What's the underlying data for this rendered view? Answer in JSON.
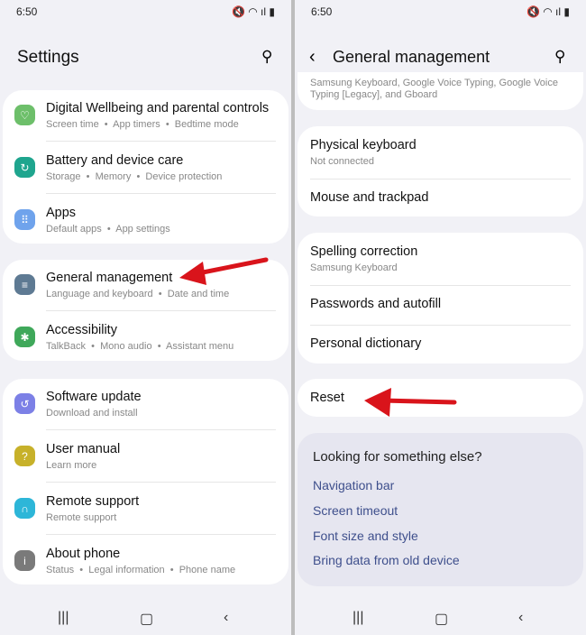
{
  "status": {
    "time": "6:50",
    "left_icons": [
      "gallery-icon",
      "dnd-icon",
      "accessibility-icon",
      "dot"
    ],
    "right_icons": [
      "mute-icon",
      "wifi-icon",
      "signal-icon",
      "battery-icon"
    ]
  },
  "left": {
    "title": "Settings",
    "groups": [
      [
        {
          "title": "Digital Wellbeing and parental controls",
          "sub": "Screen time  •  App timers  •  Bedtime mode",
          "color": "#6dbf6a",
          "icon": "wellbeing-icon",
          "glyph": "♡"
        },
        {
          "title": "Battery and device care",
          "sub": "Storage  •  Memory  •  Device protection",
          "color": "#1fa58e",
          "icon": "device-care-icon",
          "glyph": "↻"
        },
        {
          "title": "Apps",
          "sub": "Default apps  •  App settings",
          "color": "#6fa3ec",
          "icon": "apps-icon",
          "glyph": "⠿"
        }
      ],
      [
        {
          "title": "General management",
          "sub": "Language and keyboard  •  Date and time",
          "color": "#5e7a93",
          "icon": "general-management-icon",
          "glyph": "≡"
        },
        {
          "title": "Accessibility",
          "sub": "TalkBack  •  Mono audio  •  Assistant menu",
          "color": "#3fa85a",
          "icon": "accessibility-icon",
          "glyph": "✱"
        }
      ],
      [
        {
          "title": "Software update",
          "sub": "Download and install",
          "color": "#7c80e6",
          "icon": "software-update-icon",
          "glyph": "↺"
        },
        {
          "title": "User manual",
          "sub": "Learn more",
          "color": "#c7b12a",
          "icon": "user-manual-icon",
          "glyph": "?"
        },
        {
          "title": "Remote support",
          "sub": "Remote support",
          "color": "#2db6d8",
          "icon": "remote-support-icon",
          "glyph": "∩"
        },
        {
          "title": "About phone",
          "sub": "Status  •  Legal information  •  Phone name",
          "color": "#7a7a7a",
          "icon": "about-phone-icon",
          "glyph": "i"
        }
      ]
    ]
  },
  "right": {
    "title": "General management",
    "top_card_text": "Samsung Keyboard, Google Voice Typing, Google Voice Typing [Legacy], and Gboard",
    "items": [
      {
        "title": "Physical keyboard",
        "sub": "Not connected"
      },
      {
        "title": "Mouse and trackpad"
      },
      {
        "title": "Spelling correction",
        "sub": "Samsung Keyboard"
      },
      {
        "title": "Passwords and autofill"
      },
      {
        "title": "Personal dictionary"
      },
      {
        "title": "Reset"
      }
    ],
    "looking": {
      "heading": "Looking for something else?",
      "links": [
        "Navigation bar",
        "Screen timeout",
        "Font size and style",
        "Bring data from old device"
      ]
    }
  },
  "colors": {
    "arrow": "#d9141b",
    "link": "#3e4f8c"
  }
}
